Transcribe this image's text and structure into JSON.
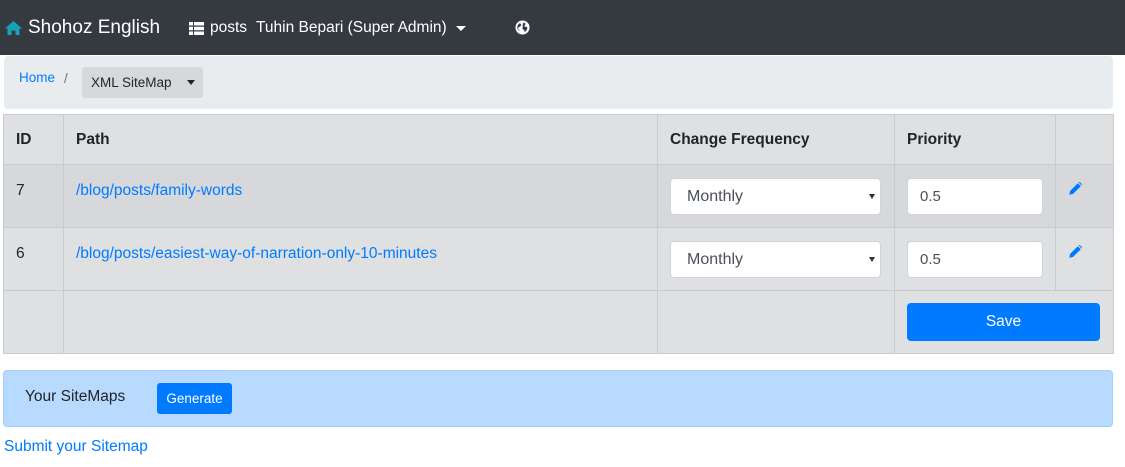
{
  "navbar": {
    "brand": "Shohoz English",
    "brand_icon": "home-icon",
    "posts_label": "posts",
    "posts_icon": "list-icon",
    "user_label": "Tuhin Bepari (Super Admin)",
    "globe_icon": "globe-icon"
  },
  "breadcrumb": {
    "home": "Home",
    "separator": "/",
    "current": "XML SiteMap"
  },
  "table": {
    "headers": [
      "ID",
      "Path",
      "Change Frequency",
      "Priority",
      ""
    ],
    "rows": [
      {
        "id": "7",
        "path": "/blog/posts/family-words",
        "frequency": "Monthly",
        "priority": "0.5"
      },
      {
        "id": "6",
        "path": "/blog/posts/easiest-way-of-narration-only-10-minutes",
        "frequency": "Monthly",
        "priority": "0.5"
      }
    ],
    "save_label": "Save",
    "edit_icon": "pencil-icon"
  },
  "sitemaps": {
    "label": "Your SiteMaps",
    "generate_label": "Generate"
  },
  "submit_link": "Submit your Sitemap",
  "colors": {
    "navbar_bg": "#343a40",
    "primary": "#007bff",
    "alert_bg": "#b8daff",
    "brand_icon": "#17a2b8"
  }
}
